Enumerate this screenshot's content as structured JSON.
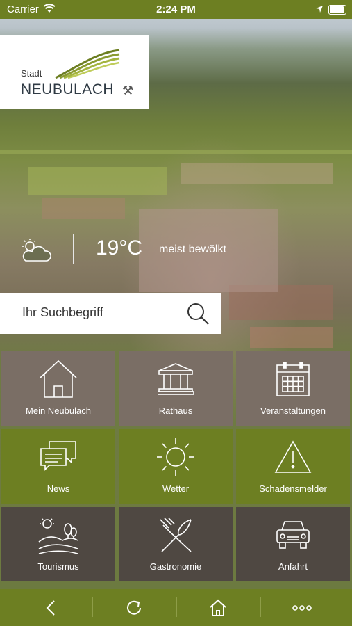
{
  "status_bar": {
    "carrier": "Carrier",
    "time": "2:24 PM"
  },
  "logo": {
    "stadt": "Stadt",
    "name": "NEUBULACH"
  },
  "weather": {
    "icon": "partly-cloudy-icon",
    "temperature": "19°C",
    "description": "meist bewölkt"
  },
  "search": {
    "placeholder": "Ihr Suchbegriff"
  },
  "tiles": [
    {
      "label": "Mein Neubulach",
      "icon": "house-icon"
    },
    {
      "label": "Rathaus",
      "icon": "townhall-icon"
    },
    {
      "label": "Veranstaltungen",
      "icon": "calendar-icon"
    },
    {
      "label": "News",
      "icon": "chat-icon"
    },
    {
      "label": "Wetter",
      "icon": "sun-icon"
    },
    {
      "label": "Schadensmelder",
      "icon": "warning-icon"
    },
    {
      "label": "Tourismus",
      "icon": "landscape-icon"
    },
    {
      "label": "Gastronomie",
      "icon": "cutlery-icon"
    },
    {
      "label": "Anfahrt",
      "icon": "car-icon"
    }
  ],
  "colors": {
    "green": "#6d7f22",
    "brown": "#7a6e65",
    "dark": "#4f4842"
  },
  "nav": {
    "back_icon": "back-icon",
    "reload_icon": "reload-icon",
    "home_icon": "home-icon",
    "more_icon": "more-icon"
  }
}
